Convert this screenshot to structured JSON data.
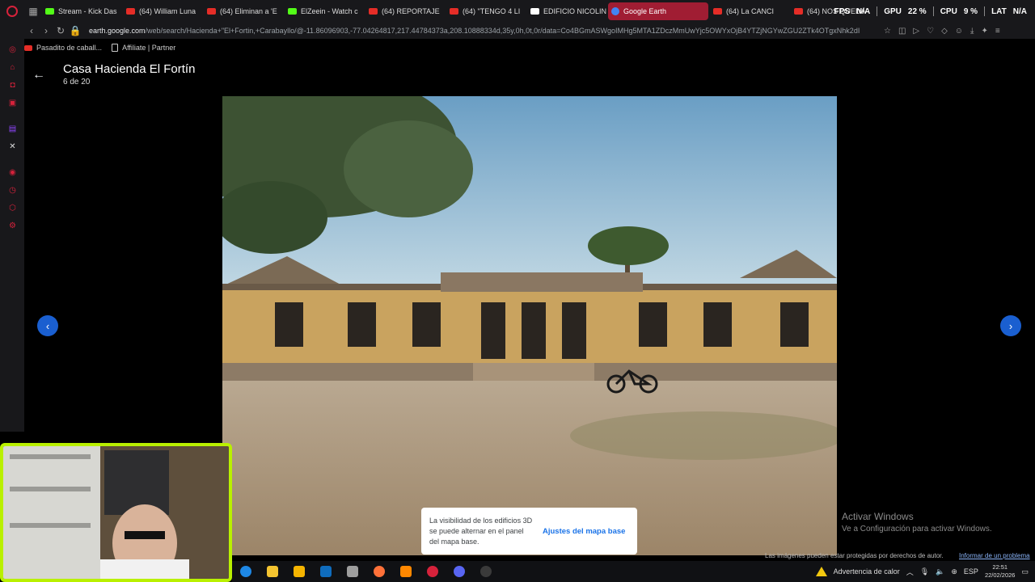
{
  "browser": {
    "tabs": [
      {
        "label": "Stream - Kick Das",
        "color": "#53fc18"
      },
      {
        "label": "(64) William Luna",
        "color": "#e52d27"
      },
      {
        "label": "(64) Eliminan a 'E",
        "color": "#e52d27"
      },
      {
        "label": "ElZeein - Watch c",
        "color": "#53fc18"
      },
      {
        "label": "(64) REPORTAJE",
        "color": "#e52d27"
      },
      {
        "label": "(64) \"TENGO 4 LI",
        "color": "#e52d27"
      },
      {
        "label": "EDIFICIO NICOLIN",
        "color": "#ffffff"
      },
      {
        "label": "Google Earth",
        "color": "#4285f4",
        "active": true
      },
      {
        "label": "(64) La CANCI",
        "color": "#e52d27"
      },
      {
        "label": "(64) NOS QUEDA",
        "color": "#e52d27"
      }
    ],
    "stats": {
      "fps_label": "FPS",
      "fps_value": "N/A",
      "cpu_label": "GPU",
      "cpu_value": "22 %",
      "cpu2_label": "CPU",
      "cpu2_value": "9 %",
      "lat_label": "LAT",
      "lat_value": "N/A"
    },
    "url_host": "earth.google.com",
    "url_path": "/web/search/Hacienda+\"El+Fortin,+Carabayllo/@-11.86096903,-77.04264817,217.44784373a,208.10888334d,35y,0h,0t,0r/data=Co4BGmASWgoIMHg5MTA1ZDczMmUwYjc5OWYxOjB4YTZjNGYwZGU2ZTk4OTgxNhk2dI",
    "bookmarks": [
      {
        "label": "Pasadito de caball..."
      },
      {
        "label": "Affiliate | Partner"
      }
    ]
  },
  "viewer": {
    "title": "Casa Hacienda El Fortín",
    "counter": "6 de 20",
    "prev_icon": "chevron-left-icon",
    "next_icon": "chevron-right-icon"
  },
  "toast": {
    "message": "La visibilidad de los edificios 3D se puede alternar en el panel del mapa base.",
    "action": "Ajustes del mapa base"
  },
  "footer": {
    "copyright": "Las imágenes pueden estar protegidas por derechos de autor.",
    "report": "Informar de un problema"
  },
  "watermark": {
    "heading": "Activar Windows",
    "sub": "Ve a Configuración para activar Windows."
  },
  "taskbar": {
    "apps": [
      {
        "name": "edge-icon",
        "color": "#1e88e5"
      },
      {
        "name": "folder-icon",
        "color": "#f4c430"
      },
      {
        "name": "store-icon",
        "color": "#f5b400"
      },
      {
        "name": "outlook-icon",
        "color": "#0f6cbd"
      },
      {
        "name": "app-icon",
        "color": "#9e9e9e"
      },
      {
        "name": "firefox-icon",
        "color": "#ff7139"
      },
      {
        "name": "vlc-icon",
        "color": "#ff8800"
      },
      {
        "name": "opera-icon",
        "color": "#d6223b"
      },
      {
        "name": "discord-icon",
        "color": "#5865f2"
      },
      {
        "name": "obs-icon",
        "color": "#3a3a3a"
      }
    ],
    "weather": "Advertencia de calor",
    "lang": "ESP",
    "time": "22:51",
    "date": "22/02/2026"
  }
}
